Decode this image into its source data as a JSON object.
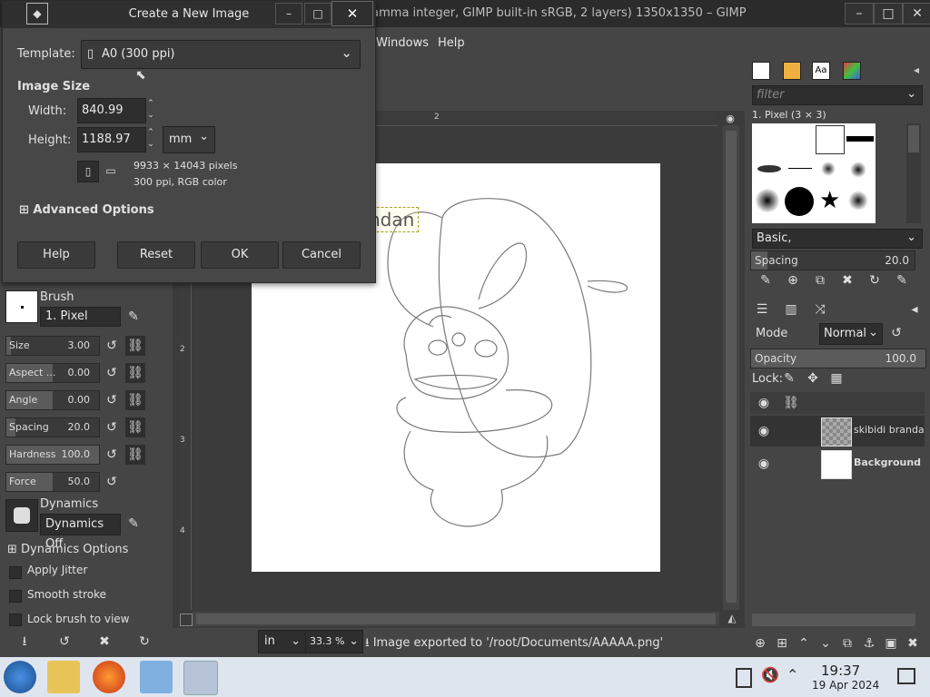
{
  "window": {
    "title": "[Untitled]-1.0 (RGB color 8-bit gamma integer, GIMP built-in sRGB, 2 layers) 1350x1350 – GIMP",
    "controls": [
      "–",
      "□",
      "✕"
    ]
  },
  "menubar": {
    "items": [
      "Windows",
      "Help"
    ]
  },
  "dialog": {
    "title": "Create a New Image",
    "template_label": "Template:",
    "template_value": "A0 (300 ppi)",
    "image_size_label": "Image Size",
    "width_label": "Width:",
    "width_value": "840.99",
    "height_label": "Height:",
    "height_value": "1188.97",
    "unit": "mm",
    "pixels_info": "9933 × 14043 pixels",
    "res_info": "300 ppi, RGB color",
    "advanced_label": "Advanced Options",
    "buttons": {
      "help": "Help",
      "reset": "Reset",
      "ok": "OK",
      "cancel": "Cancel"
    }
  },
  "canvas": {
    "text_layer_text": "ndan",
    "ruler_top_label": "2",
    "ruler_left_labels": [
      "2",
      "3",
      "4"
    ]
  },
  "tool_options": {
    "brush_label": "Brush",
    "brush_value": "1. Pixel",
    "sliders": [
      {
        "name": "Size",
        "value": "3.00",
        "fill": 0.05
      },
      {
        "name": "Aspect ...",
        "value": "0.00",
        "fill": 0.5
      },
      {
        "name": "Angle",
        "value": "0.00",
        "fill": 0.5
      },
      {
        "name": "Spacing",
        "value": "20.0",
        "fill": 0.1
      },
      {
        "name": "Hardness",
        "value": "100.0",
        "fill": 1.0
      },
      {
        "name": "Force",
        "value": "50.0",
        "fill": 0.5
      }
    ],
    "dynamics_label": "Dynamics",
    "dynamics_value": "Dynamics Off",
    "dynamics_options": "Dynamics Options",
    "checks": [
      "Apply Jitter",
      "Smooth stroke",
      "Lock brush to view"
    ]
  },
  "status": {
    "unit": "in",
    "zoom": "33.3 %",
    "message": "Image exported to '/root/Documents/AAAAA.png'"
  },
  "brushes": {
    "filter_placeholder": "filter",
    "current": "1. Pixel (3 × 3)",
    "preset": "Basic,",
    "spacing_label": "Spacing",
    "spacing_value": "20.0"
  },
  "layers": {
    "mode_label": "Mode",
    "mode_value": "Normal",
    "opacity_label": "Opacity",
    "opacity_value": "100.0",
    "lock_label": "Lock:",
    "items": [
      {
        "name": "skibidi brandan"
      },
      {
        "name": "Background"
      }
    ]
  },
  "taskbar": {
    "time": "19:37",
    "date": "19 Apr 2024"
  },
  "colors": {
    "accent": "#3a3a3a",
    "dialog_bg": "#474747",
    "taskbar_bg": "#dfe5ee"
  }
}
